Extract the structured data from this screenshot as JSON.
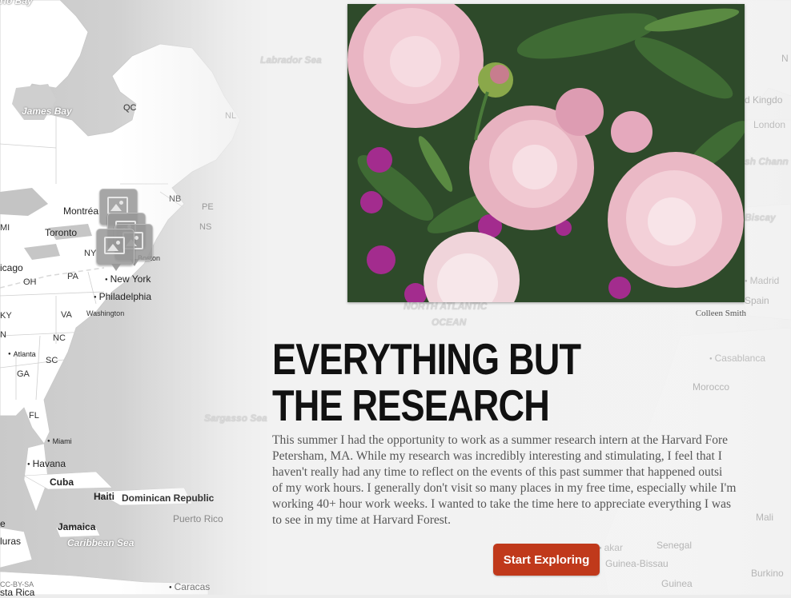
{
  "map": {
    "labels": {
      "ontario_bay": "rio Bay",
      "james_bay": "James Bay",
      "qc": "QC",
      "nl": "NL",
      "labrador_sea": "Labrador Sea",
      "nb": "NB",
      "pe": "PE",
      "ns": "NS",
      "montreal": "Montréa",
      "toronto": "Toronto",
      "mi": "MI",
      "chicago": "icago",
      "ny": "NY",
      "boston": "Boston",
      "oh": "OH",
      "pa": "PA",
      "new_york": "New York",
      "philadelphia": "Philadelphia",
      "washington": "Washington",
      "ky": "KY",
      "va": "VA",
      "n": "N",
      "nc": "NC",
      "atlanta": "Atlanta",
      "sc": "SC",
      "ga": "GA",
      "fl": "FL",
      "sargasso_sea": "Sargasso Sea",
      "miami": "Miami",
      "havana": "Havana",
      "cuba": "Cuba",
      "haiti": "Haiti",
      "dominican_republic": "Dominican Republic",
      "puerto_rico": "Puerto Rico",
      "jamaica": "Jamaica",
      "honduras": "luras",
      "caribbean_sea": "Caribbean Sea",
      "costa_rica": "sta Rica",
      "caracas": "Caracas",
      "e": "e",
      "north_atlantic": "NORTH ATLANTIC",
      "ocean": "OCEAN",
      "n_right": "N",
      "united_kingdom": "d Kingdo",
      "london": "London",
      "channel": "sh Chann",
      "biscay": "Biscay",
      "madrid": "Madrid",
      "spain": "Spain",
      "casablanca": "Casablanca",
      "morocco": "Morocco",
      "mali": "Mali",
      "dakar": "akar",
      "senegal": "Senegal",
      "guinea_bissau": "Guinea-Bissau",
      "guinea": "Guinea",
      "burkina": "Burkino"
    },
    "attribution": "CC-BY-SA"
  },
  "photo": {
    "alt": "Pink peonies and purple geraniums",
    "credit": "Colleen Smith"
  },
  "story": {
    "title": "EVERYTHING BUT THE RESEARCH",
    "description_lines": [
      "This summer I had the opportunity to work as a summer research intern at the Harvard Fore",
      "Petersham, MA. While my research was incredibly interesting and stimulating, I feel that I",
      "haven't really had any time to reflect on the events of this past summer that happened outsi",
      "of my work hours. I generally don't visit so many places in my free time, especially while I'm",
      "working 40+ hour work weeks. I wanted to take the time here to appreciate everything I was",
      "to see in my time at Harvard Forest."
    ],
    "start_button": "Start Exploring"
  },
  "colors": {
    "button": "#c0391b",
    "title": "#111111",
    "body_text": "#555555",
    "land": "#ffffff",
    "water": "#cfcfcf"
  },
  "icons": [
    "image-marker-icon"
  ]
}
